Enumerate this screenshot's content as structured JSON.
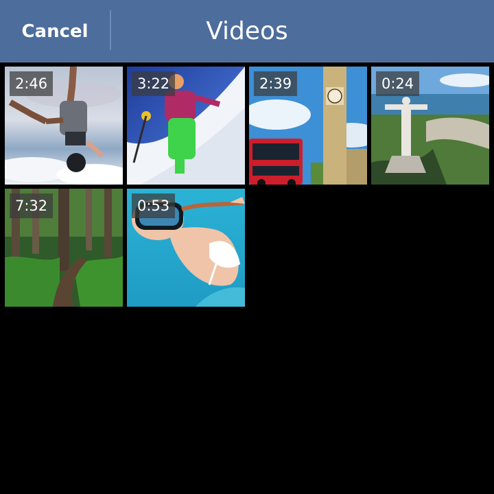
{
  "header": {
    "cancel_label": "Cancel",
    "title": "Videos",
    "background_color": "#4d6d9c"
  },
  "videos": [
    {
      "duration": "2:46",
      "thumbnail": "skydiver-upside-down"
    },
    {
      "duration": "3:22",
      "thumbnail": "skier-pink-jacket"
    },
    {
      "duration": "2:39",
      "thumbnail": "big-ben-london-bus"
    },
    {
      "duration": "0:24",
      "thumbnail": "christ-the-redeemer-rio"
    },
    {
      "duration": "7:32",
      "thumbnail": "forest-trail"
    },
    {
      "duration": "0:53",
      "thumbnail": "snorkeler-underwater"
    }
  ]
}
